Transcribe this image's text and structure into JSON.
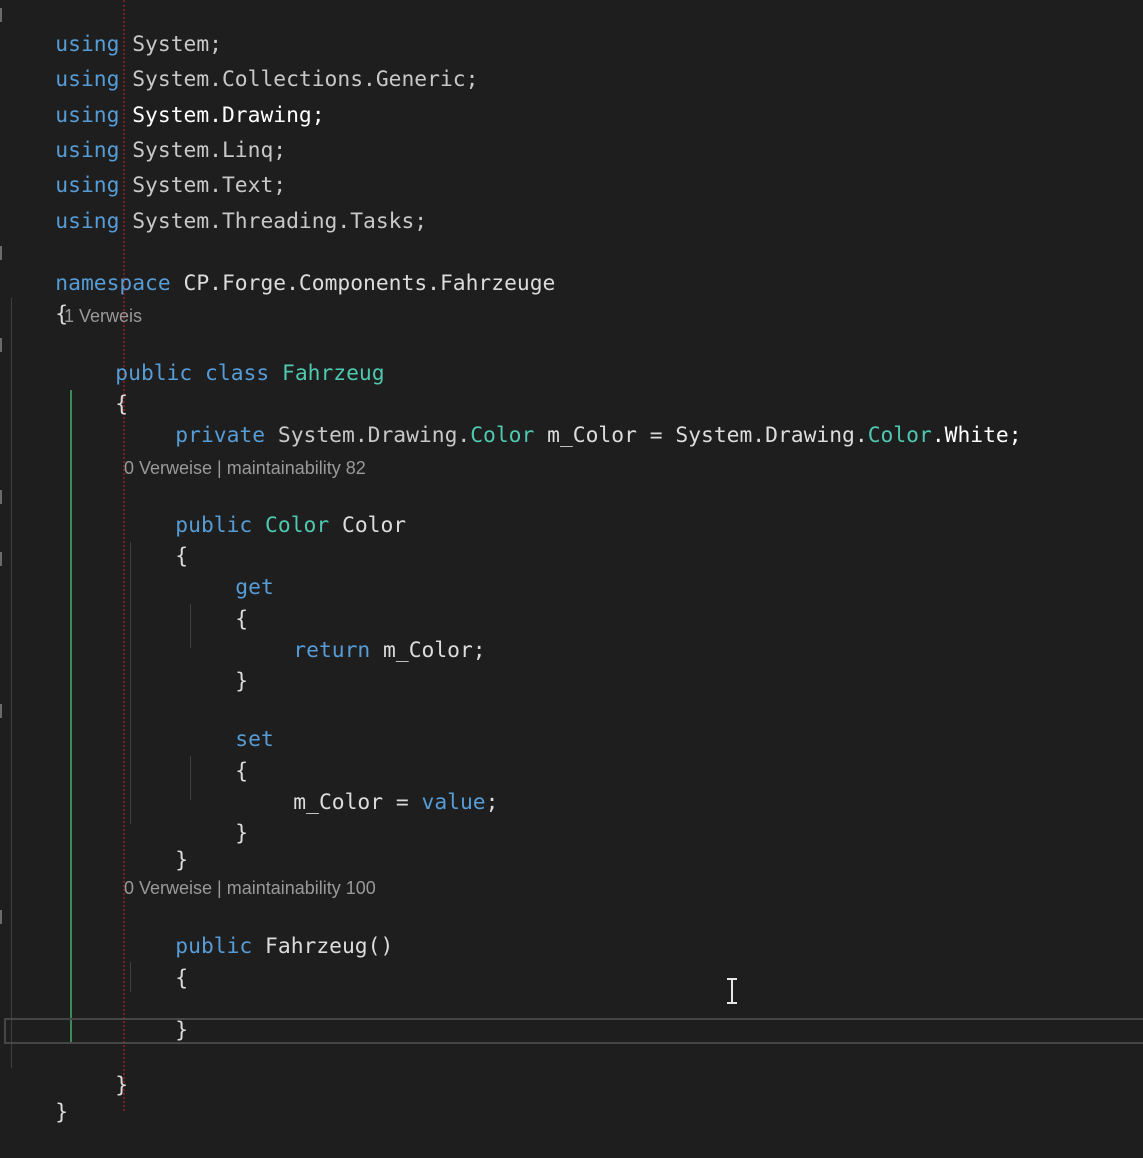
{
  "code": {
    "using1_kw": "using",
    "using1_rest": " System;",
    "using2_kw": "using",
    "using2_rest": " System.Collections.Generic;",
    "using3_kw": "using",
    "using3_rest": " System.Drawing;",
    "using4_kw": "using",
    "using4_rest": " System.Linq;",
    "using5_kw": "using",
    "using5_rest": " System.Text;",
    "using6_kw": "using",
    "using6_rest": " System.Threading.Tasks;",
    "ns_kw": "namespace",
    "ns_name": " CP.Forge.Components.Fahrzeuge",
    "open_brace": "{",
    "close_brace": "}",
    "class_public": "public",
    "class_class": " class",
    "class_name": " Fahrzeug",
    "field_private": "private",
    "field_ns1": " System.Drawing.",
    "field_type": "Color",
    "field_name": " m_Color = System.Drawing.",
    "field_type2": "Color",
    "field_end": ".White;",
    "prop_public": "public",
    "prop_type": " Color",
    "prop_name": " Color",
    "get_kw": "get",
    "return_kw": "return",
    "return_rest": " m_Color;",
    "set_kw": "set",
    "assign_rest": "m_Color = ",
    "value_kw": "value",
    "assign_end": ";",
    "ctor_public": "public",
    "ctor_rest": " Fahrzeug()"
  },
  "codelens": {
    "class_refs": "1 Verweis",
    "prop_refs": "0 Verweise | maintainability 82",
    "ctor_refs": "0 Verweise | maintainability 100"
  },
  "colors": {
    "background": "#1e1e1e",
    "keyword": "#569cd6",
    "type": "#4ec9b0",
    "text": "#dcdcdc"
  }
}
